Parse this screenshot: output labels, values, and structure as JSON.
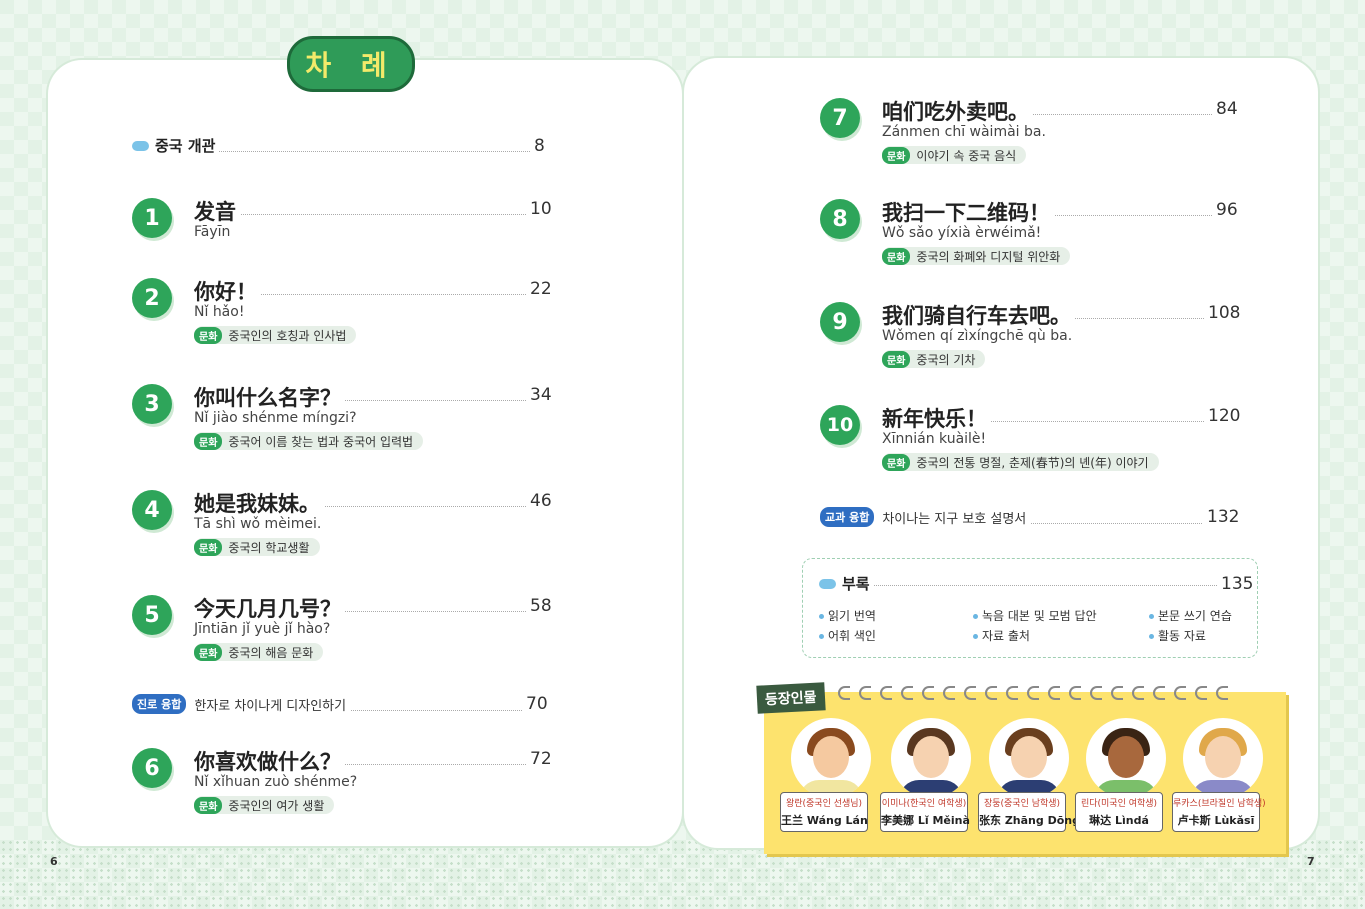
{
  "title": "차 례",
  "overview": {
    "label": "중국 개관",
    "page": "8"
  },
  "lessons": [
    {
      "num": "1",
      "cn": "发音",
      "py": "Fāyīn",
      "culture": "",
      "page": "10"
    },
    {
      "num": "2",
      "cn": "你好！",
      "py": "Nǐ hǎo!",
      "culture": "중국인의 호칭과 인사법",
      "page": "22"
    },
    {
      "num": "3",
      "cn": "你叫什么名字？",
      "py": "Nǐ jiào shénme míngzi?",
      "culture": "중국어 이름 찾는 법과 중국어 입력법",
      "page": "34"
    },
    {
      "num": "4",
      "cn": "她是我妹妹。",
      "py": "Tā shì wǒ mèimei.",
      "culture": "중국의 학교생활",
      "page": "46"
    },
    {
      "num": "5",
      "cn": "今天几月几号？",
      "py": "Jīntiān jǐ yuè jǐ hào?",
      "culture": "중국의 해음 문화",
      "page": "58"
    },
    {
      "num": "6",
      "cn": "你喜欢做什么？",
      "py": "Nǐ xǐhuan zuò shénme?",
      "culture": "중국인의 여가 생활",
      "page": "72"
    },
    {
      "num": "7",
      "cn": "咱们吃外卖吧。",
      "py": "Zánmen chī wàimài ba.",
      "culture": "이야기 속 중국 음식",
      "page": "84"
    },
    {
      "num": "8",
      "cn": "我扫一下二维码！",
      "py": "Wǒ sǎo yíxià èrwéimǎ!",
      "culture": "중국의 화폐와 디지털 위안화",
      "page": "96"
    },
    {
      "num": "9",
      "cn": "我们骑自行车去吧。",
      "py": "Wǒmen qí zìxíngchē qù ba.",
      "culture": "중국의 기차",
      "page": "108"
    },
    {
      "num": "10",
      "cn": "新年快乐！",
      "py": "Xīnnián kuàilè!",
      "culture": "중국의 전통 명절, 춘제(春节)의 녠(年) 이야기",
      "page": "120"
    }
  ],
  "culture_tag": "문화",
  "career": {
    "tag": "진로 융합",
    "label": "한자로 차이나게 디자인하기",
    "page": "70"
  },
  "subject": {
    "tag": "교과 융합",
    "label": "차이나는 지구 보호 설명서",
    "page": "132"
  },
  "appendix": {
    "label": "부록",
    "page": "135",
    "items": [
      "읽기 번역",
      "녹음 대본 및 모범 답안",
      "본문 쓰기 연습",
      "어휘 색인",
      "자료 출처",
      "활동 자료"
    ]
  },
  "cast": {
    "label": "등장인물",
    "characters": [
      {
        "ko": "왕란(중국인 선생님)",
        "zh": "王兰 Wáng Lán",
        "skin": "#f5c9a0",
        "hair": "#8a4a1e",
        "body": "#f1e6a0"
      },
      {
        "ko": "이미나(한국인 여학생)",
        "zh": "李美娜 Lǐ Měinà",
        "skin": "#f6d2b0",
        "hair": "#5a3820",
        "body": "#2c3e73"
      },
      {
        "ko": "장둥(중국인 남학생)",
        "zh": "张东 Zhāng Dōng",
        "skin": "#f6d2b0",
        "hair": "#6a3f1e",
        "body": "#2c3e73"
      },
      {
        "ko": "린다(미국인 여학생)",
        "zh": "琳达 Lìndá",
        "skin": "#a8683d",
        "hair": "#3a2414",
        "body": "#7bbf6a"
      },
      {
        "ko": "루카스(브라질인 남학생)",
        "zh": "卢卡斯 Lùkǎsī",
        "skin": "#f6d2b0",
        "hair": "#e0a84a",
        "body": "#8a8ac8"
      }
    ]
  },
  "folio": {
    "left": "6",
    "right": "7"
  }
}
